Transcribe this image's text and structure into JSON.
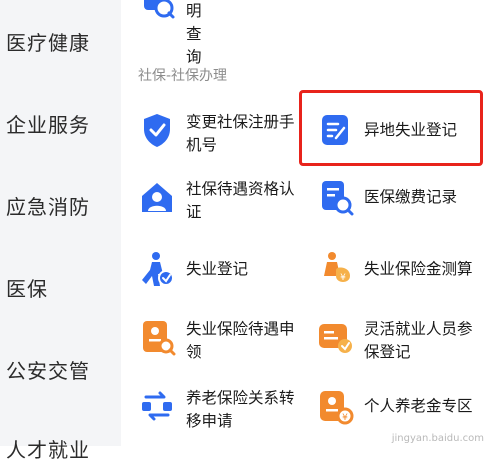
{
  "sidebar": {
    "items": [
      {
        "label": "医疗健康"
      },
      {
        "label": "企业服务"
      },
      {
        "label": "应急消防"
      },
      {
        "label": "医保"
      },
      {
        "label": "公安交管"
      },
      {
        "label": "人才就业"
      }
    ]
  },
  "top_partial": {
    "label": "明查询",
    "icon": "search-doc-icon"
  },
  "section": {
    "title": "社保-社保办理"
  },
  "services": [
    {
      "label": "变更社保注册手机号",
      "icon": "shield-check-icon"
    },
    {
      "label": "异地失业登记",
      "icon": "document-edit-icon"
    },
    {
      "label": "社保待遇资格认证",
      "icon": "house-user-icon"
    },
    {
      "label": "医保缴费记录",
      "icon": "record-search-icon"
    },
    {
      "label": "失业登记",
      "icon": "person-walking-icon"
    },
    {
      "label": "失业保险金测算",
      "icon": "money-bag-icon"
    },
    {
      "label": "失业保险待遇申领",
      "icon": "claim-form-icon"
    },
    {
      "label": "灵活就业人员参保登记",
      "icon": "register-card-icon"
    },
    {
      "label": "养老保险关系转移申请",
      "icon": "transfer-arrows-icon"
    },
    {
      "label": "个人养老金专区",
      "icon": "pension-card-icon"
    }
  ],
  "colors": {
    "accent_blue": "#2f6bf0",
    "accent_orange": "#f28a2e",
    "highlight_red": "#e8231b"
  },
  "watermark": "jingyan.baidu.com"
}
